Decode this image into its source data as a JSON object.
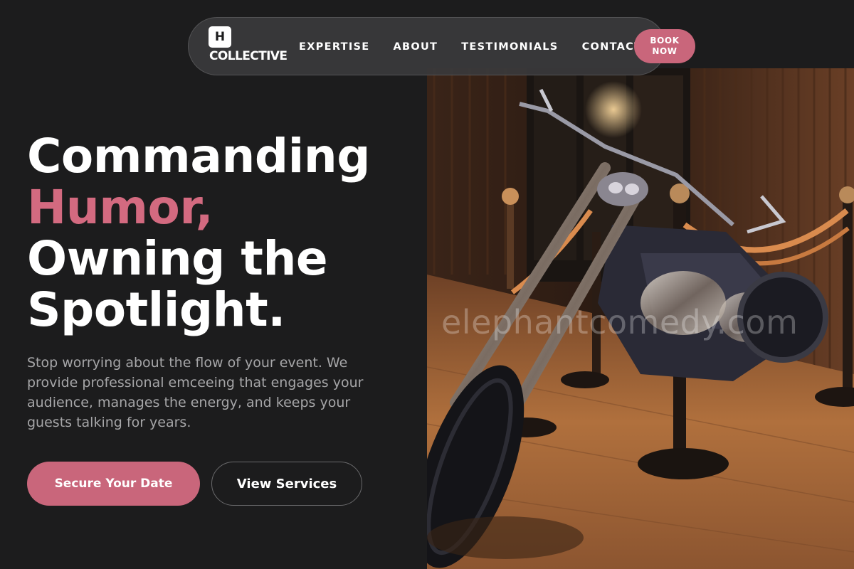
{
  "nav": {
    "logo_mark": "H",
    "logo_text": "COLLECTIVE",
    "links": [
      "EXPERTISE",
      "ABOUT",
      "TESTIMONIALS",
      "CONTACT"
    ],
    "book_line1": "BOOK",
    "book_line2": "NOW"
  },
  "hero": {
    "title_line1": "Commanding",
    "title_line2": "Humor,",
    "title_line3": "Owning the",
    "title_line4": "Spotlight.",
    "subtitle": "Stop worrying about the flow of your event. We provide professional emceeing that engages your audience, manages the energy, and keeps your guests talking for years.",
    "primary_cta": "Secure Your Date",
    "secondary_cta": "View Services",
    "watermark": "elephantcomedy.com"
  },
  "colors": {
    "background": "#1c1c1d",
    "accent": "#c9667b",
    "accent_text": "#d36a80",
    "muted_text": "#a6a6a8"
  },
  "image": {
    "subject": "motorcycle-on-display-with-rope-barriers"
  }
}
